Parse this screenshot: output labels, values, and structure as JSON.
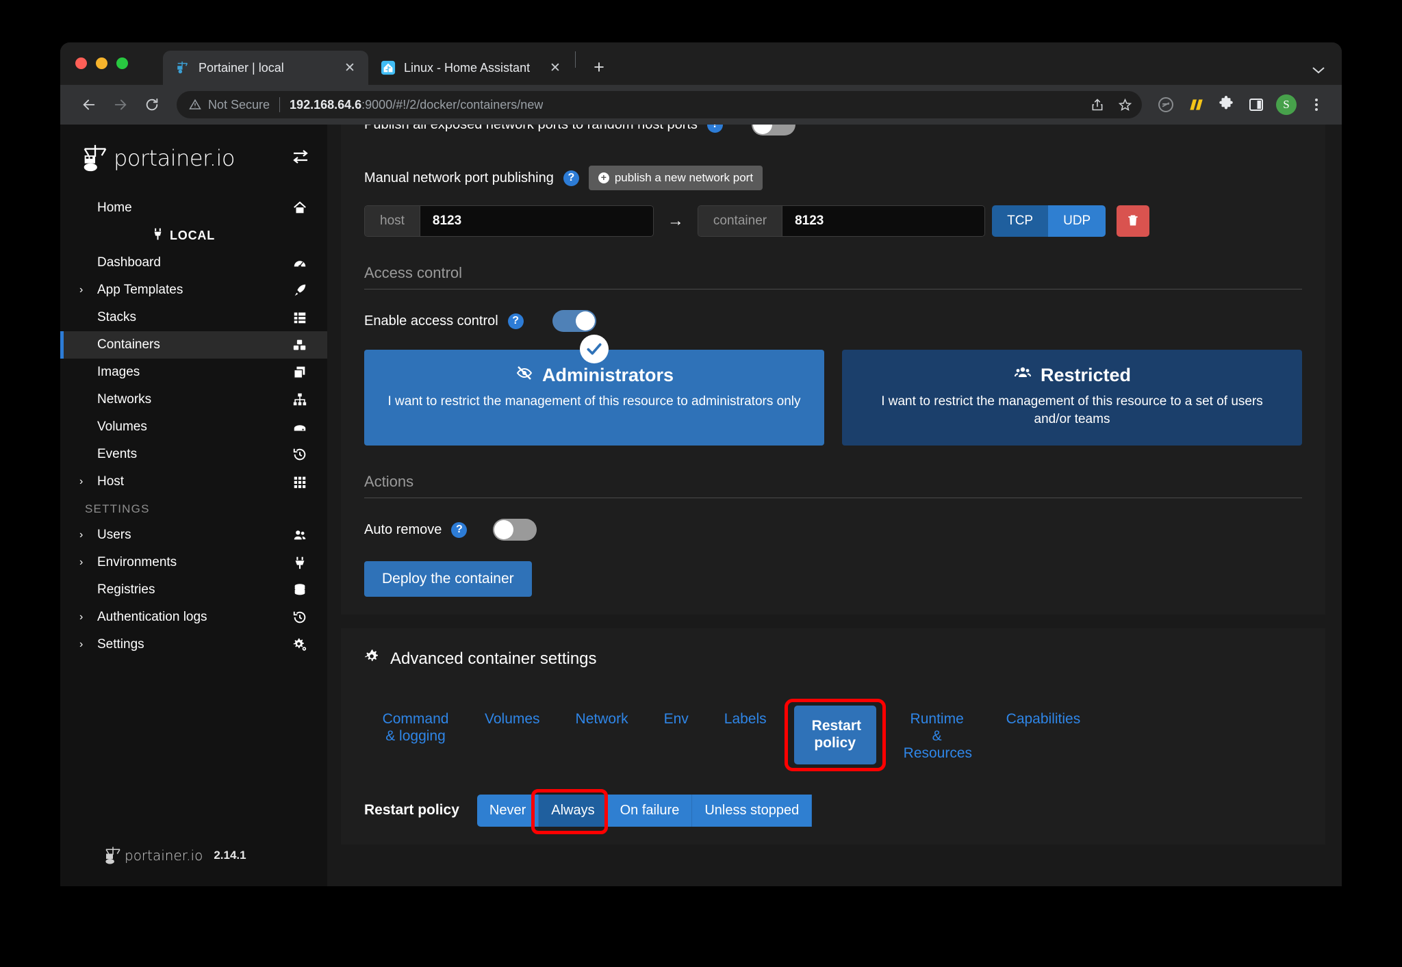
{
  "browser": {
    "tabs": [
      {
        "title": "Portainer | local",
        "favicon": "portainer-icon",
        "active": true
      },
      {
        "title": "Linux - Home Assistant",
        "favicon": "home-assistant-icon",
        "active": false
      }
    ],
    "new_tab_label": "+",
    "tab_list_chevron": "˅",
    "nav": {
      "back": "←",
      "forward": "→",
      "reload": "⟳"
    },
    "omnibox": {
      "warning_icon": "not-secure-warning-icon",
      "security_label": "Not Secure",
      "url_host": "192.168.64.6",
      "url_rest": ":9000/#!/2/docker/containers/new",
      "share_icon": "share-icon",
      "bookmark_icon": "star-icon"
    },
    "toolbar_icons": [
      "extension-circle-icon",
      "yellow-bars-icon",
      "puzzle-extension-icon",
      "side-panel-icon"
    ],
    "avatar_letter": "S",
    "menu_icon": "kebab-menu-icon"
  },
  "sidebar": {
    "brand": "portainer.io",
    "collapse_icon": "toggle-sidebar-icon",
    "home": {
      "label": "Home",
      "icon": "home-icon"
    },
    "environment": {
      "label": "LOCAL",
      "icon": "plug-icon"
    },
    "items": [
      {
        "label": "Dashboard",
        "icon": "dashboard-icon",
        "caret": false,
        "active": false
      },
      {
        "label": "App Templates",
        "icon": "rocket-icon",
        "caret": true,
        "active": false
      },
      {
        "label": "Stacks",
        "icon": "stacks-icon",
        "caret": false,
        "active": false
      },
      {
        "label": "Containers",
        "icon": "containers-icon",
        "caret": false,
        "active": true
      },
      {
        "label": "Images",
        "icon": "images-icon",
        "caret": false,
        "active": false
      },
      {
        "label": "Networks",
        "icon": "networks-icon",
        "caret": false,
        "active": false
      },
      {
        "label": "Volumes",
        "icon": "volumes-icon",
        "caret": false,
        "active": false
      },
      {
        "label": "Events",
        "icon": "history-icon",
        "caret": false,
        "active": false
      },
      {
        "label": "Host",
        "icon": "grid-icon",
        "caret": true,
        "active": false
      }
    ],
    "section_label": "SETTINGS",
    "settings_items": [
      {
        "label": "Users",
        "icon": "users-icon",
        "caret": true,
        "active": false
      },
      {
        "label": "Environments",
        "icon": "plug-icon",
        "caret": true,
        "active": false
      },
      {
        "label": "Registries",
        "icon": "database-icon",
        "caret": false,
        "active": false
      },
      {
        "label": "Authentication logs",
        "icon": "history-icon",
        "caret": true,
        "active": false
      },
      {
        "label": "Settings",
        "icon": "gears-icon",
        "caret": true,
        "active": false
      }
    ],
    "footer": {
      "brand": "portainer.io",
      "version": "2.14.1"
    }
  },
  "main": {
    "publish_all": {
      "label": "Publish all exposed network ports to random host ports",
      "help_icon": "help-icon",
      "toggle_state": "off"
    },
    "manual_ports": {
      "label": "Manual network port publishing",
      "help_icon": "help-icon",
      "add_button": "publish a new network port",
      "add_button_icon": "plus-circle-icon",
      "rows": [
        {
          "host_addon": "host",
          "host_value": "8123",
          "arrow": "→",
          "container_addon": "container",
          "container_value": "8123",
          "protocols": [
            {
              "label": "TCP",
              "selected": true
            },
            {
              "label": "UDP",
              "selected": false
            }
          ],
          "delete_icon": "trash-icon"
        }
      ]
    },
    "access_control": {
      "heading": "Access control",
      "enable_label": "Enable access control",
      "help_icon": "help-icon",
      "toggle_state": "on",
      "cards": [
        {
          "title": "Administrators",
          "icon": "eye-slash-icon",
          "description": "I want to restrict the management of this resource to administrators only",
          "selected": true,
          "check_icon": "check-icon"
        },
        {
          "title": "Restricted",
          "icon": "users-group-icon",
          "description": "I want to restrict the management of this resource to a set of users and/or teams",
          "selected": false
        }
      ]
    },
    "actions": {
      "heading": "Actions",
      "auto_remove_label": "Auto remove",
      "help_icon": "help-icon",
      "auto_remove_state": "off",
      "deploy_button": "Deploy the container"
    },
    "advanced": {
      "title": "Advanced container settings",
      "title_icon": "gear-icon",
      "tabs": [
        {
          "label": "Command & logging",
          "active": false
        },
        {
          "label": "Volumes",
          "active": false
        },
        {
          "label": "Network",
          "active": false
        },
        {
          "label": "Env",
          "active": false
        },
        {
          "label": "Labels",
          "active": false
        },
        {
          "label": "Restart policy",
          "active": true,
          "highlighted": true
        },
        {
          "label": "Runtime & Resources",
          "active": false
        },
        {
          "label": "Capabilities",
          "active": false
        }
      ],
      "restart_policy": {
        "label": "Restart policy",
        "options": [
          {
            "label": "Never",
            "selected": false
          },
          {
            "label": "Always",
            "selected": true,
            "highlighted": true
          },
          {
            "label": "On failure",
            "selected": false
          },
          {
            "label": "Unless stopped",
            "selected": false
          }
        ]
      }
    }
  },
  "colors": {
    "accent_blue": "#2f72b8",
    "sidebar_active": "#2d7cd6",
    "danger_red": "#d9534f",
    "highlight_red": "#ff0000",
    "avatar_green": "#47a14b"
  }
}
